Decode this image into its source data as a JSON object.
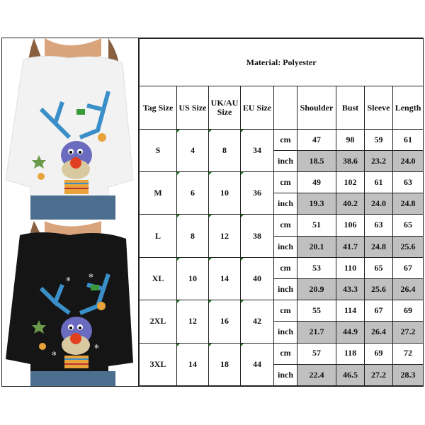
{
  "title": "Material: Polyester",
  "photos": [
    {
      "name": "white-sweatshirt-photo",
      "sweater_color": "#f4f4f4",
      "description": "White sweatshirt with colorful reindeer print"
    },
    {
      "name": "black-sweatshirt-photo",
      "sweater_color": "#141414",
      "description": "Black sweatshirt with colorful reindeer print"
    }
  ],
  "headers": {
    "tag_size": "Tag Size",
    "us_size": "US Size",
    "ukau_size_1": "UK/AU",
    "ukau_size_2": "Size",
    "eu_size": "EU Size",
    "unit": "",
    "shoulder": "Shoulder",
    "bust": "Bust",
    "sleeve": "Sleeve",
    "length": "Length"
  },
  "units": {
    "cm": "cm",
    "inch": "inch"
  },
  "rows": [
    {
      "tag": "S",
      "us": "4",
      "ukau": "8",
      "eu": "34",
      "cm": [
        "47",
        "98",
        "59",
        "61"
      ],
      "inch": [
        "18.5",
        "38.6",
        "23.2",
        "24.0"
      ]
    },
    {
      "tag": "M",
      "us": "6",
      "ukau": "10",
      "eu": "36",
      "cm": [
        "49",
        "102",
        "61",
        "63"
      ],
      "inch": [
        "19.3",
        "40.2",
        "24.0",
        "24.8"
      ]
    },
    {
      "tag": "L",
      "us": "8",
      "ukau": "12",
      "eu": "38",
      "cm": [
        "51",
        "106",
        "63",
        "65"
      ],
      "inch": [
        "20.1",
        "41.7",
        "24.8",
        "25.6"
      ]
    },
    {
      "tag": "XL",
      "us": "10",
      "ukau": "14",
      "eu": "40",
      "cm": [
        "53",
        "110",
        "65",
        "67"
      ],
      "inch": [
        "20.9",
        "43.3",
        "25.6",
        "26.4"
      ]
    },
    {
      "tag": "2XL",
      "us": "12",
      "ukau": "16",
      "eu": "42",
      "cm": [
        "55",
        "114",
        "67",
        "69"
      ],
      "inch": [
        "21.7",
        "44.9",
        "26.4",
        "27.2"
      ]
    },
    {
      "tag": "3XL",
      "us": "14",
      "ukau": "18",
      "eu": "44",
      "cm": [
        "57",
        "118",
        "69",
        "72"
      ],
      "inch": [
        "22.4",
        "46.5",
        "27.2",
        "28.3"
      ]
    }
  ],
  "colors": {
    "inch_row_bg": "#c0c0c0",
    "border": "#222222",
    "corner_marker": "#1a7a1a"
  }
}
